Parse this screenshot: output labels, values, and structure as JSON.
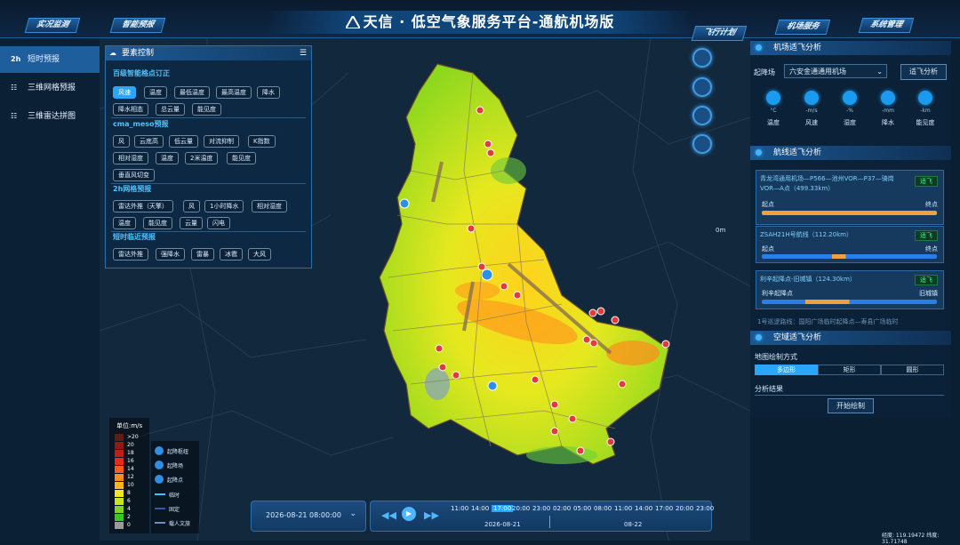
{
  "app": {
    "title": "天信 · 低空气象服务平台-通航机场版",
    "tabs": [
      "实况监测",
      "智能预报",
      "飞行计划",
      "机场服务",
      "系统管理"
    ]
  },
  "left_nav": [
    {
      "icon": "2h",
      "label": "短时预报"
    },
    {
      "icon": "grid-icon",
      "label": "三维网格预报"
    },
    {
      "icon": "grid-icon",
      "label": "三维雷达拼图"
    }
  ],
  "factor_panel": {
    "title": "要素控制",
    "sections": [
      {
        "title": "百级智能格点订正",
        "chips": [
          "风速",
          "温度",
          "最低温度",
          "最高温度",
          "降水",
          "降水相态",
          "总云量",
          "能见度"
        ]
      },
      {
        "title": "cma_meso预报",
        "chips": [
          "风",
          "云底高",
          "低云量",
          "对流抑制",
          "K指数",
          "相对湿度",
          "温度",
          "2米温度",
          "能见度",
          "垂直风切变"
        ]
      },
      {
        "title": "2h网格预报",
        "chips": [
          "雷达外推（天擎）",
          "风",
          "1小时降水",
          "相对湿度",
          "温度",
          "能见度",
          "云量",
          "闪电"
        ]
      },
      {
        "title": "短时临近预报",
        "chips": [
          "雷达外推",
          "强降水",
          "雷暴",
          "冰雹",
          "大风"
        ]
      }
    ]
  },
  "airport_panel": {
    "title": "机场适飞分析",
    "field_label": "起降场",
    "airport": "六安金通通用机场",
    "button": "适飞分析",
    "metrics": [
      {
        "unit": "°C",
        "label": "温度"
      },
      {
        "unit": "-m/s",
        "label": "风速"
      },
      {
        "unit": "-%",
        "label": "湿度"
      },
      {
        "unit": "-mm",
        "label": "降水"
      },
      {
        "unit": "-km",
        "label": "能见度"
      }
    ]
  },
  "route_panel": {
    "title": "航线适飞分析",
    "routes": [
      {
        "name": "青龙湾通用机场—P566—池州VOR—P37—骑岗VOR—A点（499.33km）",
        "status": "适飞",
        "start": "起点",
        "end": "终点"
      },
      {
        "name": "ZSAH21H号航线（112.20km）",
        "status": "适飞",
        "start": "起点",
        "end": "终点"
      },
      {
        "name": "利辛起降点-旧城镇（124.30km）",
        "status": "适飞",
        "start": "利辛起降点",
        "end": "旧城镇"
      }
    ],
    "more": "1号巡逻路线：国阳广场临时起降点—寿县广场临时"
  },
  "airspace_panel": {
    "title": "空域适飞分析",
    "draw_label": "地图绘制方式",
    "modes": [
      "多边形",
      "矩形",
      "圆形"
    ],
    "result_label": "分析结果",
    "start_button": "开始绘制"
  },
  "legend": {
    "title": "单位:m/s",
    "levels": [
      ">20",
      "20",
      "18",
      "16",
      "14",
      "12",
      "10",
      "8",
      "6",
      "4",
      "2",
      "0"
    ],
    "colors": [
      "#5a1e12",
      "#8a1e12",
      "#c01d1a",
      "#e82a1e",
      "#ff5a1e",
      "#ff8a1e",
      "#ffb41e",
      "#f5e61e",
      "#c8e61e",
      "#7ed41e",
      "#38c81e",
      "#9a9a9a"
    ]
  },
  "symbol_legend": [
    {
      "label": "起降枢纽"
    },
    {
      "label": "起降场"
    },
    {
      "label": "起降点"
    },
    {
      "label": "临时"
    },
    {
      "label": "固定"
    },
    {
      "label": "载人文旅"
    }
  ],
  "timeline": {
    "datetime": "2026-08-21 08:00:00",
    "times": [
      "11:00",
      "14:00",
      "17:00",
      "20:00",
      "23:00",
      "02:00",
      "05:00",
      "08:00",
      "11:00",
      "14:00",
      "17:00",
      "20:00",
      "23:00"
    ],
    "selected": "17:00",
    "date1": "2026-08-21",
    "date2": "08-22"
  },
  "coords": "经度: 119.19472  纬度: 31.71748",
  "scale_label": "0m"
}
